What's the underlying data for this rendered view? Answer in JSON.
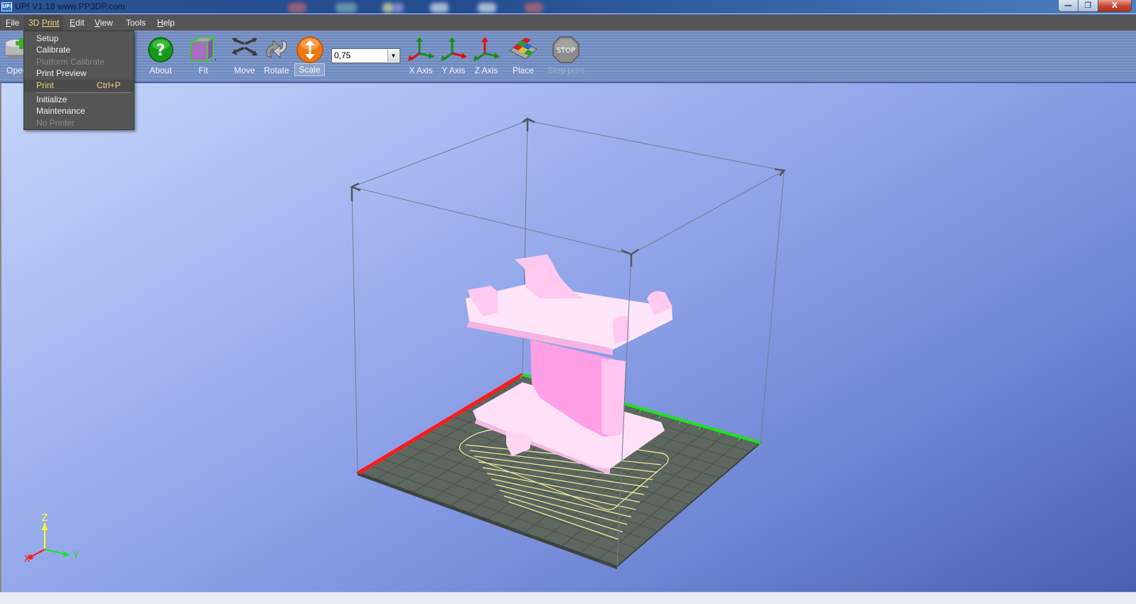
{
  "window": {
    "title": "UP!  V1.18  www.PP3DP.com",
    "app_icon_label": "UP!",
    "controls": {
      "minimize": "—",
      "restore": "❐",
      "close": "X"
    }
  },
  "menubar": {
    "items": [
      {
        "label": "File",
        "mnemonic": "F",
        "rest": "ile",
        "active": false
      },
      {
        "label": "3D Print",
        "mnemonic": "3D ",
        "rest": "Print",
        "active": true
      },
      {
        "label": "Edit",
        "mnemonic": "E",
        "rest": "dit",
        "active": false
      },
      {
        "label": "View",
        "mnemonic": "V",
        "rest": "iew",
        "active": false
      },
      {
        "label": "Tools",
        "mnemonic": "",
        "rest": "Tools",
        "active": false
      },
      {
        "label": "Help",
        "mnemonic": "H",
        "rest": "elp",
        "active": false
      }
    ]
  },
  "dropdown": {
    "items": [
      {
        "label": "Setup",
        "enabled": true
      },
      {
        "label": "Calibrate",
        "enabled": true
      },
      {
        "label": "Platform Calibrate",
        "enabled": false
      },
      {
        "label": "Print Preview",
        "enabled": true
      },
      {
        "label": "Print",
        "shortcut": "Ctrl+P",
        "enabled": true,
        "highlighted": true
      },
      {
        "label": "Initialize",
        "enabled": true
      },
      {
        "label": "Maintenance",
        "enabled": true
      },
      {
        "label": "No Printer",
        "enabled": false
      }
    ]
  },
  "toolbar": {
    "open_label": "Open",
    "about_label": "About",
    "fit_label": "Fit",
    "move_label": "Move",
    "rotate_label": "Rotate",
    "scale_label": "Scale",
    "scale_value": "0,75",
    "x_axis_label": "X Axis",
    "y_axis_label": "Y Axis",
    "z_axis_label": "Z Axis",
    "place_label": "Place",
    "stop_label": "Stop print",
    "stop_icon_text": "STOP",
    "about_icon_text": "?"
  },
  "viewport": {
    "axis_gizmo": {
      "x": "X",
      "y": "Y",
      "z": "Z"
    },
    "colors": {
      "model": "#ff9fe6",
      "platform": "#5e6660",
      "x_ruler": "#ff1a1a",
      "y_ruler": "#22e022",
      "raft": "#f4f09a"
    }
  }
}
